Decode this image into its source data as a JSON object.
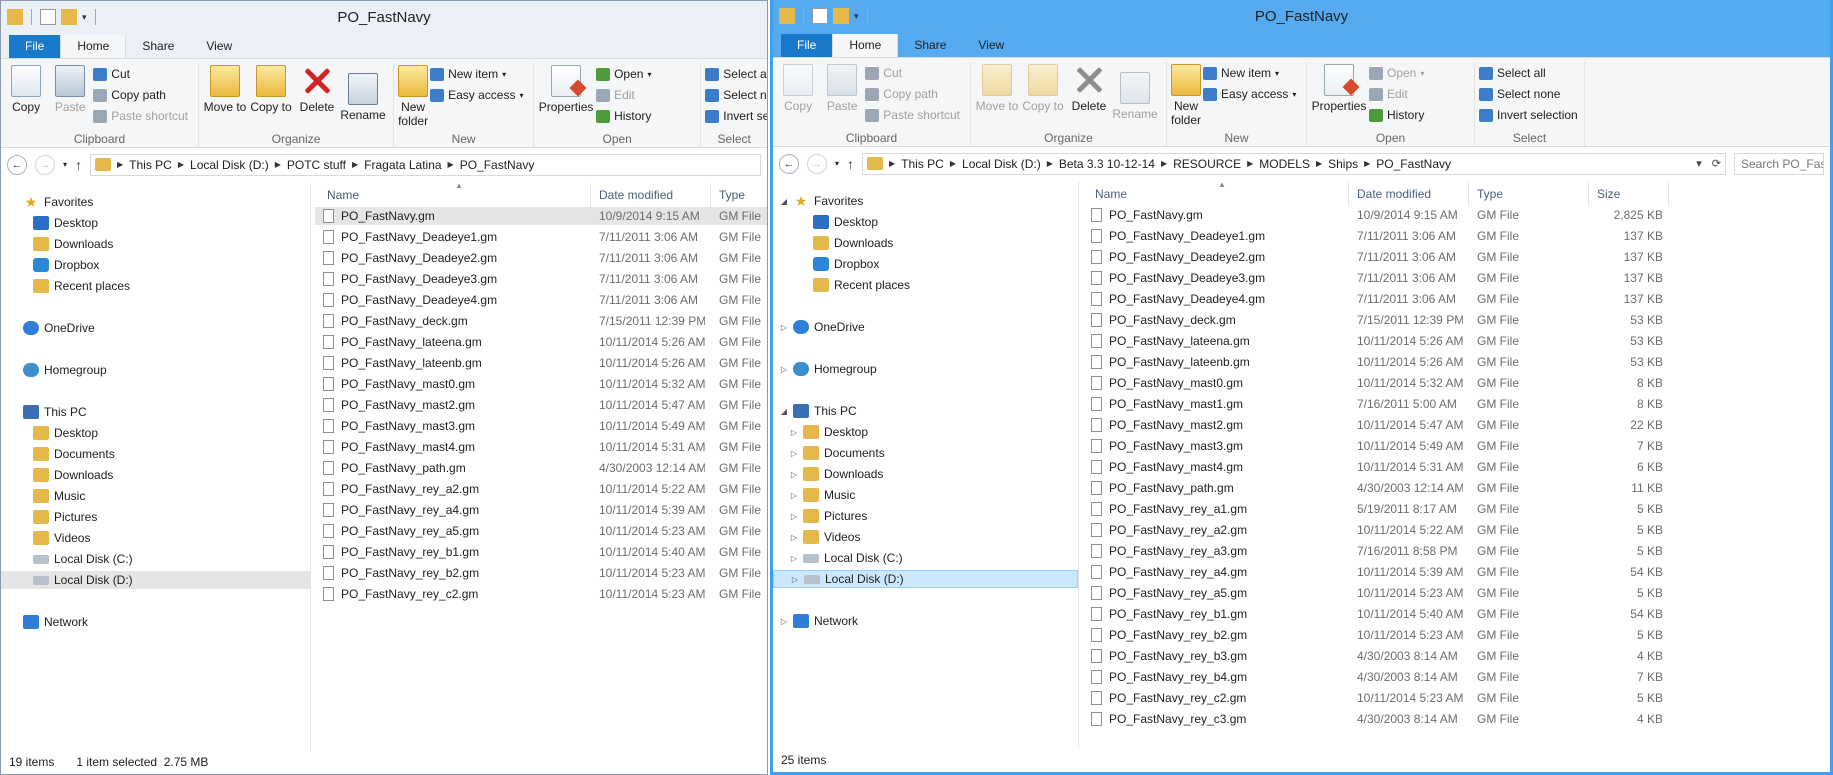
{
  "left": {
    "title": "PO_FastNavy",
    "tabs": [
      "File",
      "Home",
      "Share",
      "View"
    ],
    "ribbon": {
      "copy": "Copy",
      "paste": "Paste",
      "cut": "Cut",
      "copy_path": "Copy path",
      "paste_shortcut": "Paste shortcut",
      "clipboard": "Clipboard",
      "move_to": "Move to",
      "copy_to": "Copy to",
      "delete": "Delete",
      "rename": "Rename",
      "organize": "Organize",
      "new_folder": "New folder",
      "new_item": "New item",
      "easy_access": "Easy access",
      "new": "New",
      "properties": "Properties",
      "open": "Open",
      "edit": "Edit",
      "history": "History",
      "open_group": "Open",
      "select_all": "Select all",
      "select_none": "Select none",
      "invert_selection": "Invert selection",
      "select": "Select"
    },
    "breadcrumb": [
      "This PC",
      "Local Disk (D:)",
      "POTC stuff",
      "Fragata Latina",
      "PO_FastNavy"
    ],
    "nav": [
      {
        "label": "Favorites",
        "icon": "star-icon"
      },
      {
        "label": "Desktop",
        "icon": "desktop-icon"
      },
      {
        "label": "Downloads",
        "icon": "folder-icon"
      },
      {
        "label": "Dropbox",
        "icon": "dropbox-icon"
      },
      {
        "label": "Recent places",
        "icon": "folder-icon"
      },
      {
        "label": "OneDrive",
        "icon": "cloud-icon"
      },
      {
        "label": "Homegroup",
        "icon": "homegroup-icon"
      },
      {
        "label": "This PC",
        "icon": "pc-icon"
      },
      {
        "label": "Desktop",
        "icon": "folder-icon"
      },
      {
        "label": "Documents",
        "icon": "folder-icon"
      },
      {
        "label": "Downloads",
        "icon": "folder-icon"
      },
      {
        "label": "Music",
        "icon": "folder-icon"
      },
      {
        "label": "Pictures",
        "icon": "folder-icon"
      },
      {
        "label": "Videos",
        "icon": "folder-icon"
      },
      {
        "label": "Local Disk (C:)",
        "icon": "disk-icon"
      },
      {
        "label": "Local Disk (D:)",
        "icon": "disk-icon"
      },
      {
        "label": "Network",
        "icon": "network-icon"
      }
    ],
    "columns": [
      "Name",
      "Date modified",
      "Type"
    ],
    "files": [
      {
        "name": "PO_FastNavy.gm",
        "date": "10/9/2014 9:15 AM",
        "type": "GM File"
      },
      {
        "name": "PO_FastNavy_Deadeye1.gm",
        "date": "7/11/2011 3:06 AM",
        "type": "GM File"
      },
      {
        "name": "PO_FastNavy_Deadeye2.gm",
        "date": "7/11/2011 3:06 AM",
        "type": "GM File"
      },
      {
        "name": "PO_FastNavy_Deadeye3.gm",
        "date": "7/11/2011 3:06 AM",
        "type": "GM File"
      },
      {
        "name": "PO_FastNavy_Deadeye4.gm",
        "date": "7/11/2011 3:06 AM",
        "type": "GM File"
      },
      {
        "name": "PO_FastNavy_deck.gm",
        "date": "7/15/2011 12:39 PM",
        "type": "GM File"
      },
      {
        "name": "PO_FastNavy_lateena.gm",
        "date": "10/11/2014 5:26 AM",
        "type": "GM File"
      },
      {
        "name": "PO_FastNavy_lateenb.gm",
        "date": "10/11/2014 5:26 AM",
        "type": "GM File"
      },
      {
        "name": "PO_FastNavy_mast0.gm",
        "date": "10/11/2014 5:32 AM",
        "type": "GM File"
      },
      {
        "name": "PO_FastNavy_mast2.gm",
        "date": "10/11/2014 5:47 AM",
        "type": "GM File"
      },
      {
        "name": "PO_FastNavy_mast3.gm",
        "date": "10/11/2014 5:49 AM",
        "type": "GM File"
      },
      {
        "name": "PO_FastNavy_mast4.gm",
        "date": "10/11/2014 5:31 AM",
        "type": "GM File"
      },
      {
        "name": "PO_FastNavy_path.gm",
        "date": "4/30/2003 12:14 AM",
        "type": "GM File"
      },
      {
        "name": "PO_FastNavy_rey_a2.gm",
        "date": "10/11/2014 5:22 AM",
        "type": "GM File"
      },
      {
        "name": "PO_FastNavy_rey_a4.gm",
        "date": "10/11/2014 5:39 AM",
        "type": "GM File"
      },
      {
        "name": "PO_FastNavy_rey_a5.gm",
        "date": "10/11/2014 5:23 AM",
        "type": "GM File"
      },
      {
        "name": "PO_FastNavy_rey_b1.gm",
        "date": "10/11/2014 5:40 AM",
        "type": "GM File"
      },
      {
        "name": "PO_FastNavy_rey_b2.gm",
        "date": "10/11/2014 5:23 AM",
        "type": "GM File"
      },
      {
        "name": "PO_FastNavy_rey_c2.gm",
        "date": "10/11/2014 5:23 AM",
        "type": "GM File"
      }
    ],
    "status_count": "19 items",
    "status_selected": "1 item selected  2.75 MB"
  },
  "right": {
    "title": "PO_FastNavy",
    "tabs": [
      "File",
      "Home",
      "Share",
      "View"
    ],
    "ribbon": {
      "copy": "Copy",
      "paste": "Paste",
      "cut": "Cut",
      "copy_path": "Copy path",
      "paste_shortcut": "Paste shortcut",
      "clipboard": "Clipboard",
      "move_to": "Move to",
      "copy_to": "Copy to",
      "delete": "Delete",
      "rename": "Rename",
      "organize": "Organize",
      "new_folder": "New folder",
      "new_item": "New item",
      "easy_access": "Easy access",
      "new": "New",
      "properties": "Properties",
      "open": "Open",
      "edit": "Edit",
      "history": "History",
      "open_group": "Open",
      "select_all": "Select all",
      "select_none": "Select none",
      "invert_selection": "Invert selection",
      "select": "Select"
    },
    "breadcrumb": [
      "This PC",
      "Local Disk (D:)",
      "Beta 3.3 10-12-14",
      "RESOURCE",
      "MODELS",
      "Ships",
      "PO_FastNavy"
    ],
    "search_placeholder": "Search PO_Fast",
    "nav": [
      {
        "label": "Favorites",
        "icon": "star-icon",
        "expand": "◢"
      },
      {
        "label": "Desktop",
        "icon": "desktop-icon",
        "expand": ""
      },
      {
        "label": "Downloads",
        "icon": "folder-icon",
        "expand": ""
      },
      {
        "label": "Dropbox",
        "icon": "dropbox-icon",
        "expand": ""
      },
      {
        "label": "Recent places",
        "icon": "folder-icon",
        "expand": ""
      },
      {
        "label": "OneDrive",
        "icon": "cloud-icon",
        "expand": "▷"
      },
      {
        "label": "Homegroup",
        "icon": "homegroup-icon",
        "expand": "▷"
      },
      {
        "label": "This PC",
        "icon": "pc-icon",
        "expand": "◢"
      },
      {
        "label": "Desktop",
        "icon": "folder-icon",
        "expand": "▷"
      },
      {
        "label": "Documents",
        "icon": "folder-icon",
        "expand": "▷"
      },
      {
        "label": "Downloads",
        "icon": "folder-icon",
        "expand": "▷"
      },
      {
        "label": "Music",
        "icon": "folder-icon",
        "expand": "▷"
      },
      {
        "label": "Pictures",
        "icon": "folder-icon",
        "expand": "▷"
      },
      {
        "label": "Videos",
        "icon": "folder-icon",
        "expand": "▷"
      },
      {
        "label": "Local Disk (C:)",
        "icon": "disk-icon",
        "expand": "▷"
      },
      {
        "label": "Local Disk (D:)",
        "icon": "disk-icon",
        "expand": "▷"
      },
      {
        "label": "Network",
        "icon": "network-icon",
        "expand": "▷"
      }
    ],
    "columns": [
      "Name",
      "Date modified",
      "Type",
      "Size"
    ],
    "files": [
      {
        "name": "PO_FastNavy.gm",
        "date": "10/9/2014 9:15 AM",
        "type": "GM File",
        "size": "2,825 KB"
      },
      {
        "name": "PO_FastNavy_Deadeye1.gm",
        "date": "7/11/2011 3:06 AM",
        "type": "GM File",
        "size": "137 KB"
      },
      {
        "name": "PO_FastNavy_Deadeye2.gm",
        "date": "7/11/2011 3:06 AM",
        "type": "GM File",
        "size": "137 KB"
      },
      {
        "name": "PO_FastNavy_Deadeye3.gm",
        "date": "7/11/2011 3:06 AM",
        "type": "GM File",
        "size": "137 KB"
      },
      {
        "name": "PO_FastNavy_Deadeye4.gm",
        "date": "7/11/2011 3:06 AM",
        "type": "GM File",
        "size": "137 KB"
      },
      {
        "name": "PO_FastNavy_deck.gm",
        "date": "7/15/2011 12:39 PM",
        "type": "GM File",
        "size": "53 KB"
      },
      {
        "name": "PO_FastNavy_lateena.gm",
        "date": "10/11/2014 5:26 AM",
        "type": "GM File",
        "size": "53 KB"
      },
      {
        "name": "PO_FastNavy_lateenb.gm",
        "date": "10/11/2014 5:26 AM",
        "type": "GM File",
        "size": "53 KB"
      },
      {
        "name": "PO_FastNavy_mast0.gm",
        "date": "10/11/2014 5:32 AM",
        "type": "GM File",
        "size": "8 KB"
      },
      {
        "name": "PO_FastNavy_mast1.gm",
        "date": "7/16/2011 5:00 AM",
        "type": "GM File",
        "size": "8 KB"
      },
      {
        "name": "PO_FastNavy_mast2.gm",
        "date": "10/11/2014 5:47 AM",
        "type": "GM File",
        "size": "22 KB"
      },
      {
        "name": "PO_FastNavy_mast3.gm",
        "date": "10/11/2014 5:49 AM",
        "type": "GM File",
        "size": "7 KB"
      },
      {
        "name": "PO_FastNavy_mast4.gm",
        "date": "10/11/2014 5:31 AM",
        "type": "GM File",
        "size": "6 KB"
      },
      {
        "name": "PO_FastNavy_path.gm",
        "date": "4/30/2003 12:14 AM",
        "type": "GM File",
        "size": "11 KB"
      },
      {
        "name": "PO_FastNavy_rey_a1.gm",
        "date": "5/19/2011 8:17 AM",
        "type": "GM File",
        "size": "5 KB"
      },
      {
        "name": "PO_FastNavy_rey_a2.gm",
        "date": "10/11/2014 5:22 AM",
        "type": "GM File",
        "size": "5 KB"
      },
      {
        "name": "PO_FastNavy_rey_a3.gm",
        "date": "7/16/2011 8:58 PM",
        "type": "GM File",
        "size": "5 KB"
      },
      {
        "name": "PO_FastNavy_rey_a4.gm",
        "date": "10/11/2014 5:39 AM",
        "type": "GM File",
        "size": "54 KB"
      },
      {
        "name": "PO_FastNavy_rey_a5.gm",
        "date": "10/11/2014 5:23 AM",
        "type": "GM File",
        "size": "5 KB"
      },
      {
        "name": "PO_FastNavy_rey_b1.gm",
        "date": "10/11/2014 5:40 AM",
        "type": "GM File",
        "size": "54 KB"
      },
      {
        "name": "PO_FastNavy_rey_b2.gm",
        "date": "10/11/2014 5:23 AM",
        "type": "GM File",
        "size": "5 KB"
      },
      {
        "name": "PO_FastNavy_rey_b3.gm",
        "date": "4/30/2003 8:14 AM",
        "type": "GM File",
        "size": "4 KB"
      },
      {
        "name": "PO_FastNavy_rey_b4.gm",
        "date": "4/30/2003 8:14 AM",
        "type": "GM File",
        "size": "7 KB"
      },
      {
        "name": "PO_FastNavy_rey_c2.gm",
        "date": "10/11/2014 5:23 AM",
        "type": "GM File",
        "size": "5 KB"
      },
      {
        "name": "PO_FastNavy_rey_c3.gm",
        "date": "4/30/2003 8:14 AM",
        "type": "GM File",
        "size": "4 KB"
      }
    ],
    "status_count": "25 items"
  }
}
